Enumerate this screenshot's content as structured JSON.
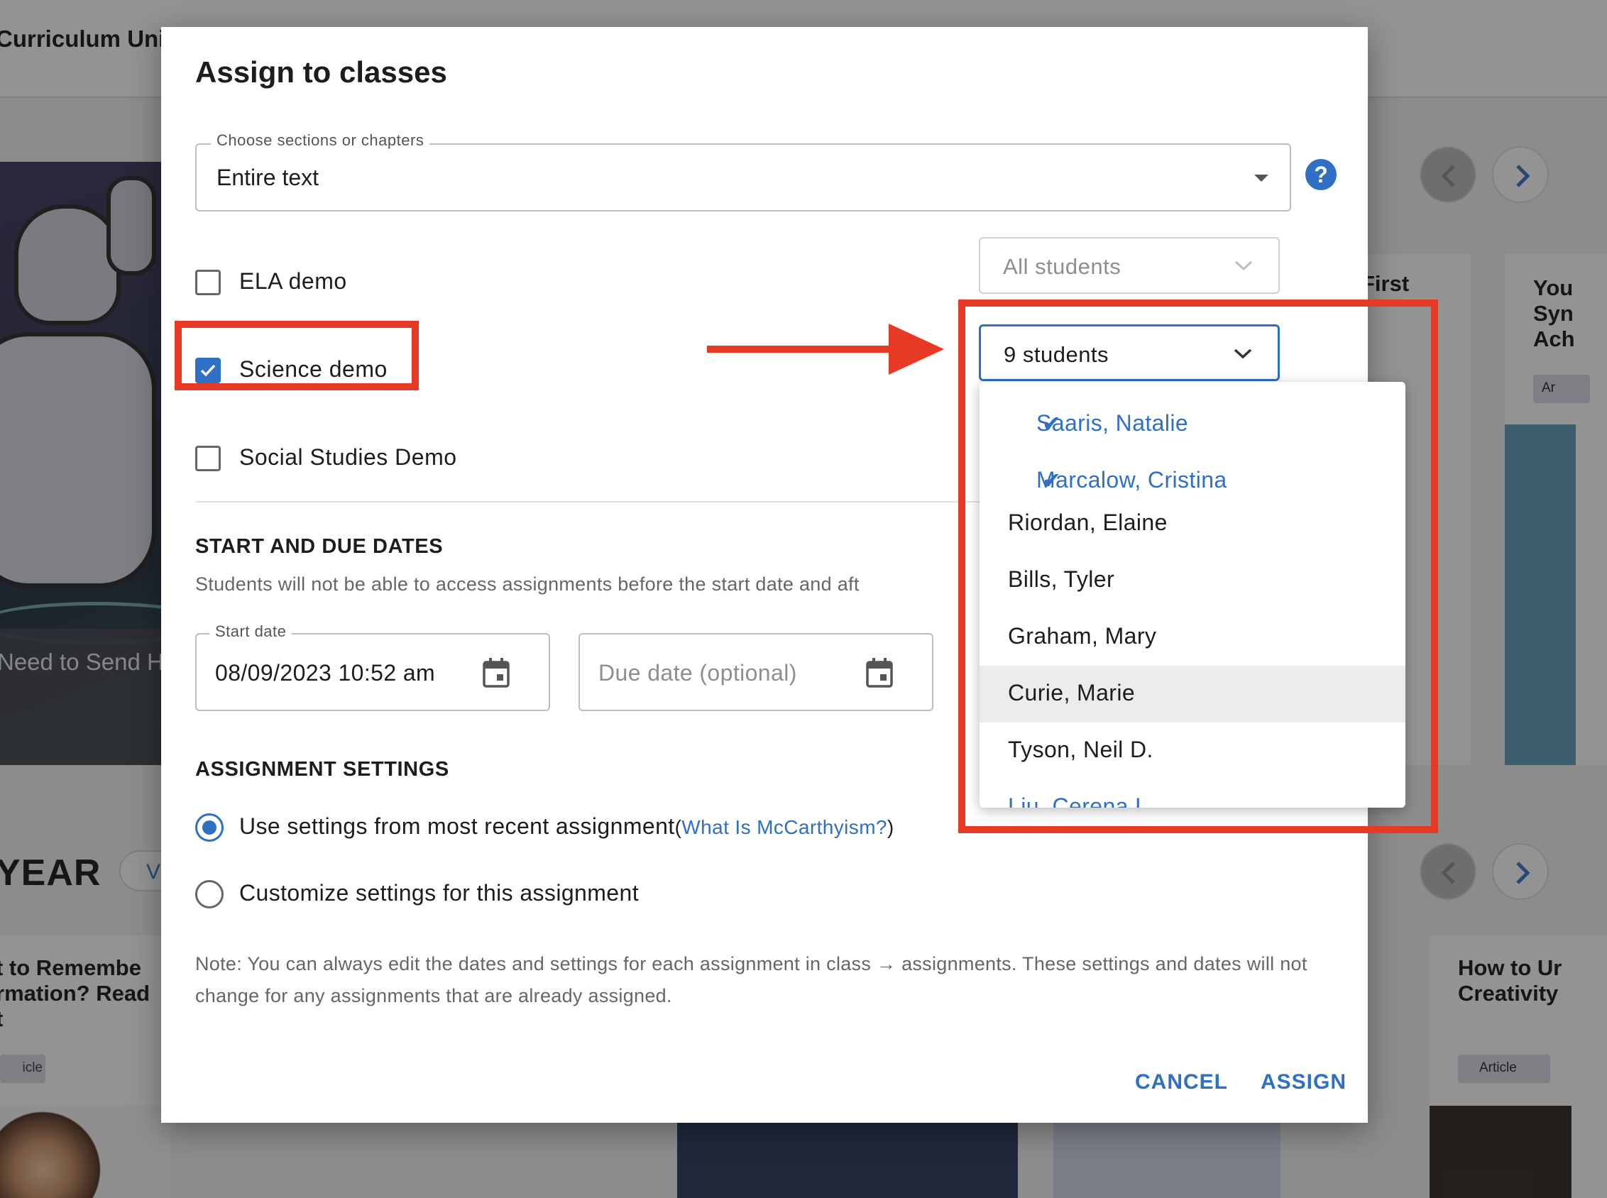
{
  "background": {
    "header_title": "Curriculum Unit",
    "hero_caption": "Need to Send H",
    "section_title": "YEAR",
    "view_pill": "V",
    "card_left_title": "t to Remembe\nrmation? Read\nt",
    "card_left_tag": "icle",
    "card_mid_title": "First",
    "card_right_col_title": "You\nSyn\nAch",
    "card_right_col_tag": "Ar",
    "card_right_title": "How to Ur\nCreativity",
    "card_right_tag": "Article"
  },
  "modal": {
    "title": "Assign to classes",
    "sections_select": {
      "legend": "Choose sections or chapters",
      "value": "Entire text"
    },
    "help_icon": "?",
    "classes": [
      {
        "label": "ELA demo",
        "checked": false,
        "students": "All students"
      },
      {
        "label": "Science demo",
        "checked": true,
        "students": "9 students"
      },
      {
        "label": "Social Studies Demo",
        "checked": false
      }
    ],
    "dates": {
      "heading": "START AND DUE DATES",
      "description": "Students will not be able to access assignments before the start date and aft",
      "start_legend": "Start date",
      "start_value": "08/09/2023 10:52 am",
      "due_placeholder": "Due date (optional)"
    },
    "settings": {
      "heading": "ASSIGNMENT SETTINGS",
      "option_recent": "Use settings from most recent assignment",
      "option_recent_open": "(",
      "option_recent_link": "What Is McCarthyism?",
      "option_recent_close": ")",
      "option_custom": "Customize settings for this assignment"
    },
    "note": "Note: You can always edit the dates and settings for each assignment in class → assignments. These settings and dates will not change for any assignments that are already assigned.",
    "cancel_label": "CANCEL",
    "assign_label": "ASSIGN"
  },
  "student_dropdown": {
    "items": [
      {
        "name": "Saaris, Natalie",
        "selected": true
      },
      {
        "name": "Marcalow, Cristina",
        "selected": true
      },
      {
        "name": "Riordan, Elaine",
        "selected": false
      },
      {
        "name": "Bills, Tyler",
        "selected": false
      },
      {
        "name": "Graham, Mary",
        "selected": false
      },
      {
        "name": "Curie, Marie",
        "selected": false,
        "highlighted": true
      },
      {
        "name": "Tyson, Neil D.",
        "selected": false
      },
      {
        "name": "Liu, Cerena L.",
        "selected": false
      }
    ],
    "check_glyph": "✔"
  },
  "colors": {
    "accent": "#2f6fc4",
    "annotation_red": "#e63a25"
  }
}
